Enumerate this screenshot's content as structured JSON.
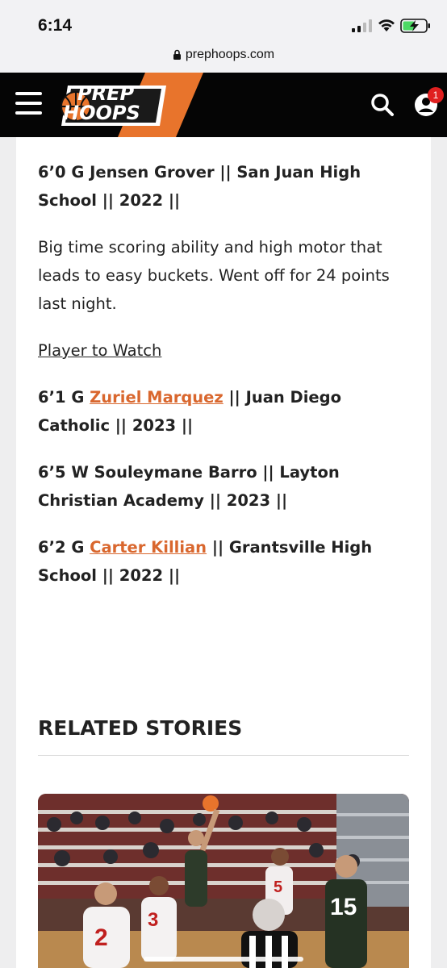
{
  "status": {
    "time": "6:14"
  },
  "browser": {
    "url": "prephoops.com"
  },
  "header": {
    "logo_line1": "PREP",
    "logo_line2": "HOOPS",
    "notification_count": "1",
    "brand_orange": "#e8742c"
  },
  "article": {
    "player1_line": "6’0 G Jensen Grover || San Juan High School || 2022 ||",
    "player1_desc": "Big time scoring ability and high motor that leads to easy buckets. Went off for 24 points last night.",
    "section_heading": "Player to Watch",
    "player2_prefix": "6’1 G ",
    "player2_name": "Zuriel Marquez",
    "player2_suffix": " || Juan Diego Catholic || 2023 ||",
    "player3_line": "6’5 W Souleymane Barro || Layton Christian Academy || 2023 ||",
    "player4_prefix": "6’2 G ",
    "player4_name": "Carter Killian",
    "player4_suffix": " || Grantsville High School || 2022 ||",
    "link_color": "#d9672e"
  },
  "related": {
    "title": "RELATED STORIES"
  }
}
